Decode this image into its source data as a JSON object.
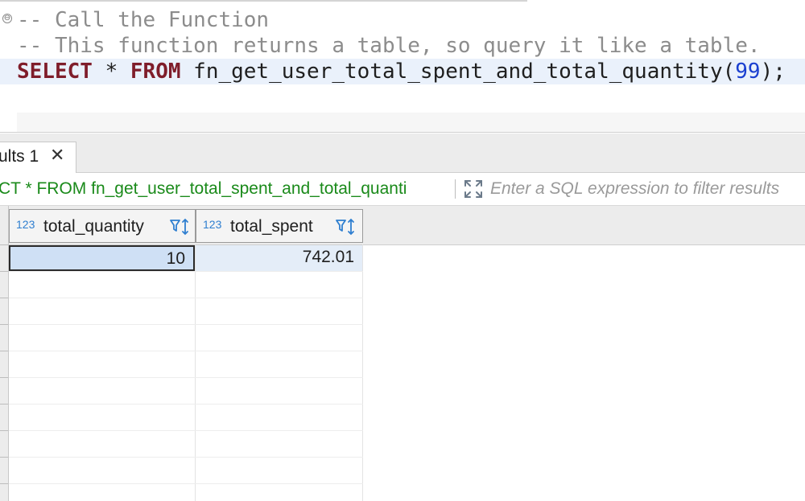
{
  "editor": {
    "fold_icon": "⊖",
    "line1": "-- Call the Function",
    "line2": "-- This function returns a table, so query it like a table.",
    "line3": {
      "kw_select": "SELECT",
      "star": " * ",
      "kw_from": "FROM",
      "func": " fn_get_user_total_spent_and_total_quantity(",
      "arg": "99",
      "close": ");"
    }
  },
  "results_tab": {
    "label": "ults 1",
    "close_glyph": "✕"
  },
  "filter_bar": {
    "query_text": "ECT * FROM fn_get_user_total_spent_and_total_quanti",
    "placeholder": "Enter a SQL expression to filter results",
    "expand_icon": "expand-arrows-icon"
  },
  "grid": {
    "columns": [
      {
        "type_badge": "123",
        "name": "total_quantity"
      },
      {
        "type_badge": "123",
        "name": "total_spent"
      }
    ],
    "rows": [
      [
        "10",
        "742.01"
      ]
    ]
  },
  "colors": {
    "keyword": "#7f1d2a",
    "comment": "#8c8c8c",
    "number": "#1a3fd0",
    "query_text": "#1a8a1a",
    "type_badge": "#2f7fd0",
    "selected_cell": "#cfe0f5"
  }
}
